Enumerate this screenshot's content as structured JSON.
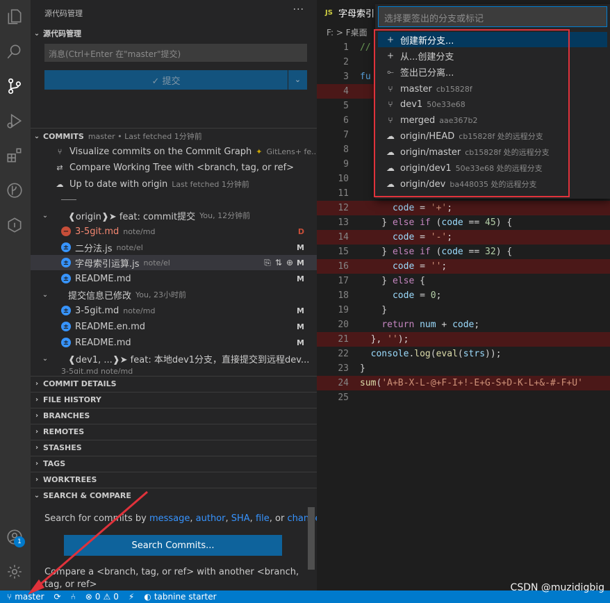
{
  "sidebar": {
    "title": "源代码管理",
    "scm_section": "源代码管理",
    "commit_placeholder": "消息(Ctrl+Enter 在\"master\"提交)",
    "commit_button": "✓ 提交",
    "commits": {
      "header": "COMMITS",
      "sub": "master • Last fetched 1分钟前",
      "visualize": "Visualize commits on the Commit Graph",
      "visualize_tag": "GitLens+ fe...",
      "compare": "Compare Working Tree with <branch, tag, or ref>",
      "uptodate": "Up to date with origin",
      "uptodate_sub": "Last fetched 1分钟前",
      "commit1": {
        "label": "❰origin❱➤  feat: commit提交",
        "meta": "You, 12分钟前",
        "files": [
          {
            "name": "3-5git.md",
            "path": "note/md",
            "status": "D"
          },
          {
            "name": "二分法.js",
            "path": "note/el",
            "status": "M"
          },
          {
            "name": "字母索引运算.js",
            "path": "note/el",
            "status": "M"
          },
          {
            "name": "README.md",
            "path": "",
            "status": "M"
          }
        ]
      },
      "commit2": {
        "label": "提交信息已修改",
        "meta": "You, 23小时前",
        "files": [
          {
            "name": "3-5git.md",
            "path": "note/md",
            "status": "M"
          },
          {
            "name": "README.en.md",
            "path": "",
            "status": "M"
          },
          {
            "name": "README.md",
            "path": "",
            "status": "M"
          }
        ]
      },
      "commit3": {
        "label": "❰dev1, ...❱➤  feat: 本地dev1分支，直接提交到远程dev...",
        "file": "3-5git.md note/md"
      }
    },
    "sections": [
      "COMMIT DETAILS",
      "FILE HISTORY",
      "BRANCHES",
      "REMOTES",
      "STASHES",
      "TAGS",
      "WORKTREES",
      "SEARCH & COMPARE"
    ],
    "search": {
      "prefix": "Search for commits by",
      "links": [
        "message",
        "author",
        "SHA",
        "file"
      ],
      "or": "or",
      "last": "changes",
      "button": "Search Commits...",
      "compare": "Compare a <branch, tag, or ref> with another <branch, tag, or ref>"
    }
  },
  "editor": {
    "tab": "字母索引",
    "breadcrumb": "F: > F桌面",
    "lines": [
      "1",
      "2",
      "3",
      "4",
      "5",
      "6",
      "7",
      "8",
      "9",
      "10",
      "11",
      "12",
      "13",
      "14",
      "15",
      "16",
      "17",
      "18",
      "19",
      "20",
      "21",
      "22",
      "23",
      "24",
      "25"
    ]
  },
  "quickpick": {
    "placeholder": "选择要签出的分支或标记",
    "actions": [
      "创建新分支...",
      "从...创建分支",
      "签出已分离..."
    ],
    "branches": [
      {
        "name": "master",
        "desc": "cb15828f"
      },
      {
        "name": "dev1",
        "desc": "50e33e68"
      },
      {
        "name": "merged",
        "desc": "aae367b2"
      },
      {
        "name": "origin/HEAD",
        "desc": "cb15828f 处的远程分支"
      },
      {
        "name": "origin/master",
        "desc": "cb15828f 处的远程分支"
      },
      {
        "name": "origin/dev1",
        "desc": "50e33e68 处的远程分支"
      },
      {
        "name": "origin/dev",
        "desc": "ba448035 处的远程分支"
      }
    ]
  },
  "statusbar": {
    "branch": "master",
    "errors": "0",
    "warnings": "0",
    "tabnine": "tabnine starter",
    "watermark": "CSDN @muzidigbig"
  },
  "colors": {
    "accent": "#007acc",
    "highlight": "#e0323b",
    "deleted_line": "#4b1818"
  }
}
